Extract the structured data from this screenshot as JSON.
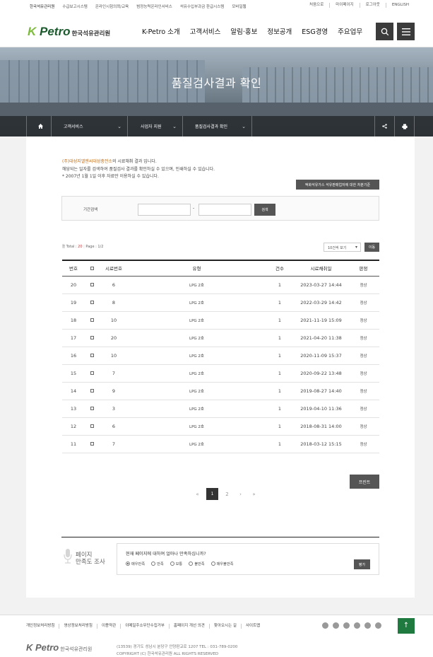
{
  "util": {
    "left_links": [
      "한국석유관리원",
      "수급보고시스템",
      "온라인시험의뢰/교육",
      "범정능력온라인서비스",
      "석유수입부과금 환급시스템",
      "모바일웹"
    ],
    "right_links": [
      "처음으로",
      "마이페이지",
      "로그아웃",
      "ENGLISH"
    ]
  },
  "header": {
    "logo_k": "K",
    "logo_petro": "Petro",
    "logo_kor": "한국석유관리원",
    "menu": [
      "K-Petro 소개",
      "고객서비스",
      "알림·홍보",
      "정보공개",
      "ESG경영",
      "주요업무"
    ]
  },
  "hero": {
    "title": "품질검사결과 확인"
  },
  "location": {
    "items": [
      "고객서비스",
      "사업자 지원",
      "품질검사결과 확인"
    ]
  },
  "notice": {
    "company": "(주)대성지엘엔씨대성충전소",
    "line1_suffix": "의 시료채취 결과 입니다.",
    "line2": "해당되는 일자를 검색하여 품질검사 결과를 확인하실 수 있으며, 인쇄하실 수 있습니다.",
    "line3": "* 2007년 1월 1일 이후 자료만 이용하실 수 있습니다.",
    "criteria_button": "액화석유가스 석유판매업자에 대한 처분기준"
  },
  "search": {
    "label": "기간검색",
    "dash": "-",
    "button": "검색"
  },
  "list_meta": {
    "total_label": "Total : ",
    "total_value": "20",
    "page_label": "Page : ",
    "page_value": "1/2",
    "per_page": "10건씩 보기",
    "move_button": "이동"
  },
  "table": {
    "headers": [
      "번호",
      "",
      "시료번호",
      "유형",
      "건수",
      "시료채취일",
      "판정"
    ],
    "rows": [
      [
        "20",
        "6",
        "LPG 2호",
        "1",
        "2023-03-27 14:44",
        "정상"
      ],
      [
        "19",
        "8",
        "LPG 2호",
        "1",
        "2022-03-29 14:42",
        "정상"
      ],
      [
        "18",
        "10",
        "LPG 2호",
        "1",
        "2021-11-19 15:09",
        "정상"
      ],
      [
        "17",
        "20",
        "LPG 2호",
        "1",
        "2021-04-20 11:38",
        "정상"
      ],
      [
        "16",
        "10",
        "LPG 2호",
        "1",
        "2020-11-09 15:37",
        "정상"
      ],
      [
        "15",
        "7",
        "LPG 2호",
        "1",
        "2020-09-22 13:48",
        "정상"
      ],
      [
        "14",
        "9",
        "LPG 2호",
        "1",
        "2019-08-27 14:40",
        "정상"
      ],
      [
        "13",
        "3",
        "LPG 2호",
        "1",
        "2019-04-10 11:36",
        "정상"
      ],
      [
        "12",
        "6",
        "LPG 2호",
        "1",
        "2018-08-31 14:00",
        "정상"
      ],
      [
        "11",
        "7",
        "LPG 2호",
        "1",
        "2018-03-12 15:15",
        "정상"
      ]
    ]
  },
  "print_button": "프린트",
  "pager": {
    "first": "«",
    "prev": "‹",
    "current": "1",
    "page2": "2",
    "next": "›",
    "last": "»"
  },
  "satisfaction": {
    "title1": "페이지",
    "title2": "만족도 조사",
    "question": "현재 페이지에 대하여 얼마나 만족하십니까?",
    "options": [
      "매우만족",
      "만족",
      "보통",
      "불만족",
      "매우불만족"
    ],
    "submit": "평가"
  },
  "footer": {
    "links": [
      "개인정보처리방침",
      "영상정보처리방침",
      "이용약관",
      "이메일주소무단수집거부",
      "홈페이지 개선 의견",
      "찾아오시는 길",
      "사이트맵"
    ],
    "address": "(13539) 경기도 성남시 분당구 안양판교로 1207  TEL : 031-789-0200",
    "copyright": "COPYRIGHT (C) 한국석유관리원 ALL RIGHTS RESERVED",
    "top_label": "↑"
  }
}
